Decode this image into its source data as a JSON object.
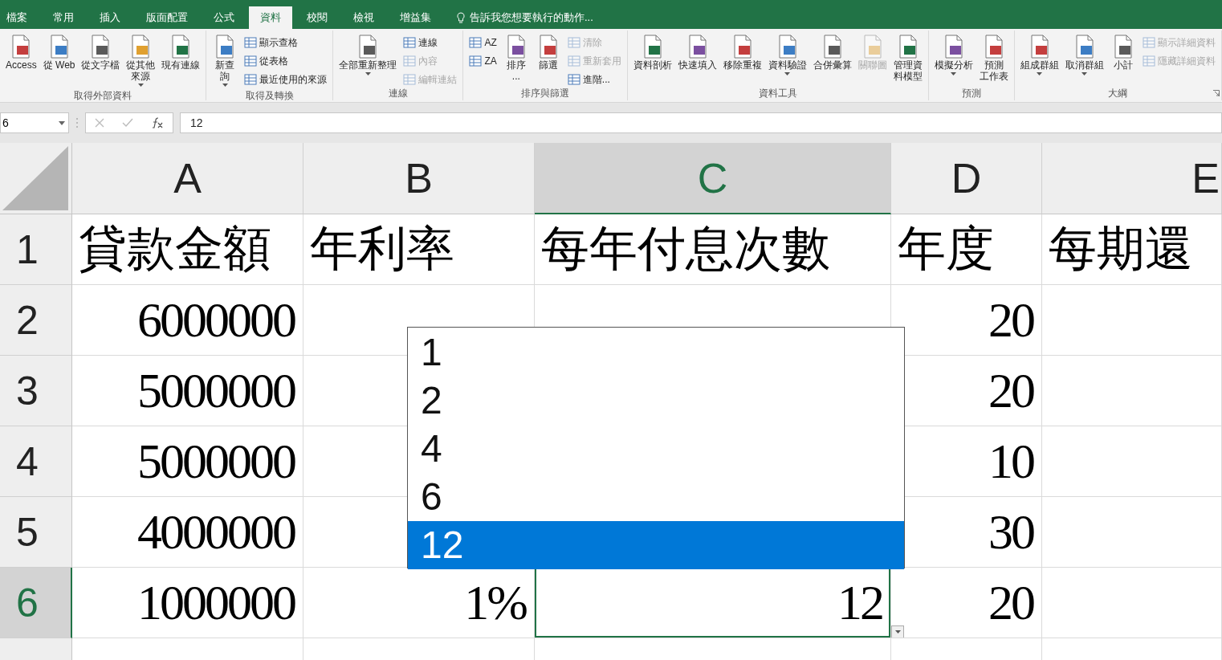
{
  "tabs": [
    {
      "label": "檔案",
      "selected": false
    },
    {
      "label": "常用",
      "selected": false
    },
    {
      "label": "插入",
      "selected": false
    },
    {
      "label": "版面配置",
      "selected": false
    },
    {
      "label": "公式",
      "selected": false
    },
    {
      "label": "資料",
      "selected": true
    },
    {
      "label": "校閱",
      "selected": false
    },
    {
      "label": "檢視",
      "selected": false
    },
    {
      "label": "增益集",
      "selected": false
    }
  ],
  "tell_me": "告訴我您想要執行的動作...",
  "ribbon": {
    "groups": [
      {
        "label": "取得外部資料",
        "buttons": [
          {
            "kind": "large",
            "lines": [
              "Access"
            ],
            "disabled": false
          },
          {
            "kind": "large",
            "lines": [
              "從 Web"
            ],
            "disabled": false
          },
          {
            "kind": "large",
            "lines": [
              "從文字檔"
            ],
            "disabled": false
          },
          {
            "kind": "large",
            "lines": [
              "從其他",
              "來源"
            ],
            "disabled": false,
            "dropdown": true
          },
          {
            "kind": "large",
            "lines": [
              "現有連線"
            ],
            "disabled": false
          }
        ]
      },
      {
        "label": "取得及轉換",
        "buttons": [
          {
            "kind": "large",
            "lines": [
              "新查",
              "詢"
            ],
            "disabled": false,
            "dropdown": true
          },
          {
            "kind": "small",
            "lines": [
              "顯示查格"
            ],
            "disabled": false
          },
          {
            "kind": "small",
            "lines": [
              "從表格"
            ],
            "disabled": false
          },
          {
            "kind": "small",
            "lines": [
              "最近使用的來源"
            ],
            "disabled": false
          }
        ]
      },
      {
        "label": "連線",
        "buttons": [
          {
            "kind": "large",
            "lines": [
              "全部重新整理"
            ],
            "disabled": false,
            "dropdown": true
          },
          {
            "kind": "small",
            "lines": [
              "連線"
            ],
            "disabled": false
          },
          {
            "kind": "small",
            "lines": [
              "內容"
            ],
            "disabled": true
          },
          {
            "kind": "small",
            "lines": [
              "編輯連結"
            ],
            "disabled": true
          }
        ]
      },
      {
        "label": "排序與篩選",
        "buttons": [
          {
            "kind": "icon",
            "lines": [
              "AZ"
            ],
            "disabled": false
          },
          {
            "kind": "icon",
            "lines": [
              "ZA"
            ],
            "disabled": false
          },
          {
            "kind": "large",
            "lines": [
              "排序",
              "..."
            ],
            "disabled": false
          },
          {
            "kind": "large",
            "lines": [
              "篩選"
            ],
            "disabled": false
          },
          {
            "kind": "small",
            "lines": [
              "清除"
            ],
            "disabled": true
          },
          {
            "kind": "small",
            "lines": [
              "重新套用"
            ],
            "disabled": true
          },
          {
            "kind": "small",
            "lines": [
              "進階..."
            ],
            "disabled": false
          }
        ]
      },
      {
        "label": "資料工具",
        "buttons": [
          {
            "kind": "large",
            "lines": [
              "資料剖析"
            ],
            "disabled": false
          },
          {
            "kind": "large",
            "lines": [
              "快速填入"
            ],
            "disabled": false
          },
          {
            "kind": "large",
            "lines": [
              "移除重複"
            ],
            "disabled": false
          },
          {
            "kind": "large",
            "lines": [
              "資料驗證"
            ],
            "disabled": false,
            "dropdown": true
          },
          {
            "kind": "large",
            "lines": [
              "合併彙算"
            ],
            "disabled": false
          },
          {
            "kind": "large",
            "lines": [
              "關聯圖"
            ],
            "disabled": true
          },
          {
            "kind": "large",
            "lines": [
              "管理資",
              "料模型"
            ],
            "disabled": false
          }
        ]
      },
      {
        "label": "預測",
        "buttons": [
          {
            "kind": "large",
            "lines": [
              "模擬分析"
            ],
            "disabled": false,
            "dropdown": true
          },
          {
            "kind": "large",
            "lines": [
              "預測",
              "工作表"
            ],
            "disabled": false
          }
        ]
      },
      {
        "label": "大綱",
        "launcher": true,
        "buttons": [
          {
            "kind": "large",
            "lines": [
              "組成群組"
            ],
            "disabled": false,
            "dropdown": true
          },
          {
            "kind": "large",
            "lines": [
              "取消群組"
            ],
            "disabled": false,
            "dropdown": true
          },
          {
            "kind": "large",
            "lines": [
              "小計"
            ],
            "disabled": false
          },
          {
            "kind": "small",
            "lines": [
              "顯示詳細資料"
            ],
            "disabled": true
          },
          {
            "kind": "small",
            "lines": [
              "隱藏詳細資料"
            ],
            "disabled": true
          }
        ]
      }
    ]
  },
  "formula_bar": {
    "name_box": "6",
    "value": "12"
  },
  "columns": [
    {
      "label": "A",
      "selected": false
    },
    {
      "label": "B",
      "selected": false
    },
    {
      "label": "C",
      "selected": true
    },
    {
      "label": "D",
      "selected": false
    },
    {
      "label": "E",
      "selected": false
    }
  ],
  "rows": [
    {
      "number": "1",
      "kind": "header",
      "selected": false,
      "cells": [
        "貸款金額",
        "年利率",
        "每年付息次數",
        "年度",
        "每期還"
      ]
    },
    {
      "number": "2",
      "kind": "data",
      "selected": false,
      "cells": [
        "6000000",
        null,
        null,
        "20",
        null
      ]
    },
    {
      "number": "3",
      "kind": "data",
      "selected": false,
      "cells": [
        "5000000",
        null,
        null,
        "20",
        null
      ]
    },
    {
      "number": "4",
      "kind": "data",
      "selected": false,
      "cells": [
        "5000000",
        null,
        null,
        "10",
        null
      ]
    },
    {
      "number": "5",
      "kind": "data",
      "selected": false,
      "cells": [
        "4000000",
        null,
        null,
        "30",
        null
      ]
    },
    {
      "number": "6",
      "kind": "data",
      "selected": true,
      "cells": [
        "1000000",
        "1%",
        "12",
        "20",
        null
      ]
    }
  ],
  "dropdown": {
    "options": [
      {
        "label": "1",
        "selected": false
      },
      {
        "label": "2",
        "selected": false
      },
      {
        "label": "4",
        "selected": false
      },
      {
        "label": "6",
        "selected": false
      },
      {
        "label": "12",
        "selected": true
      }
    ]
  }
}
